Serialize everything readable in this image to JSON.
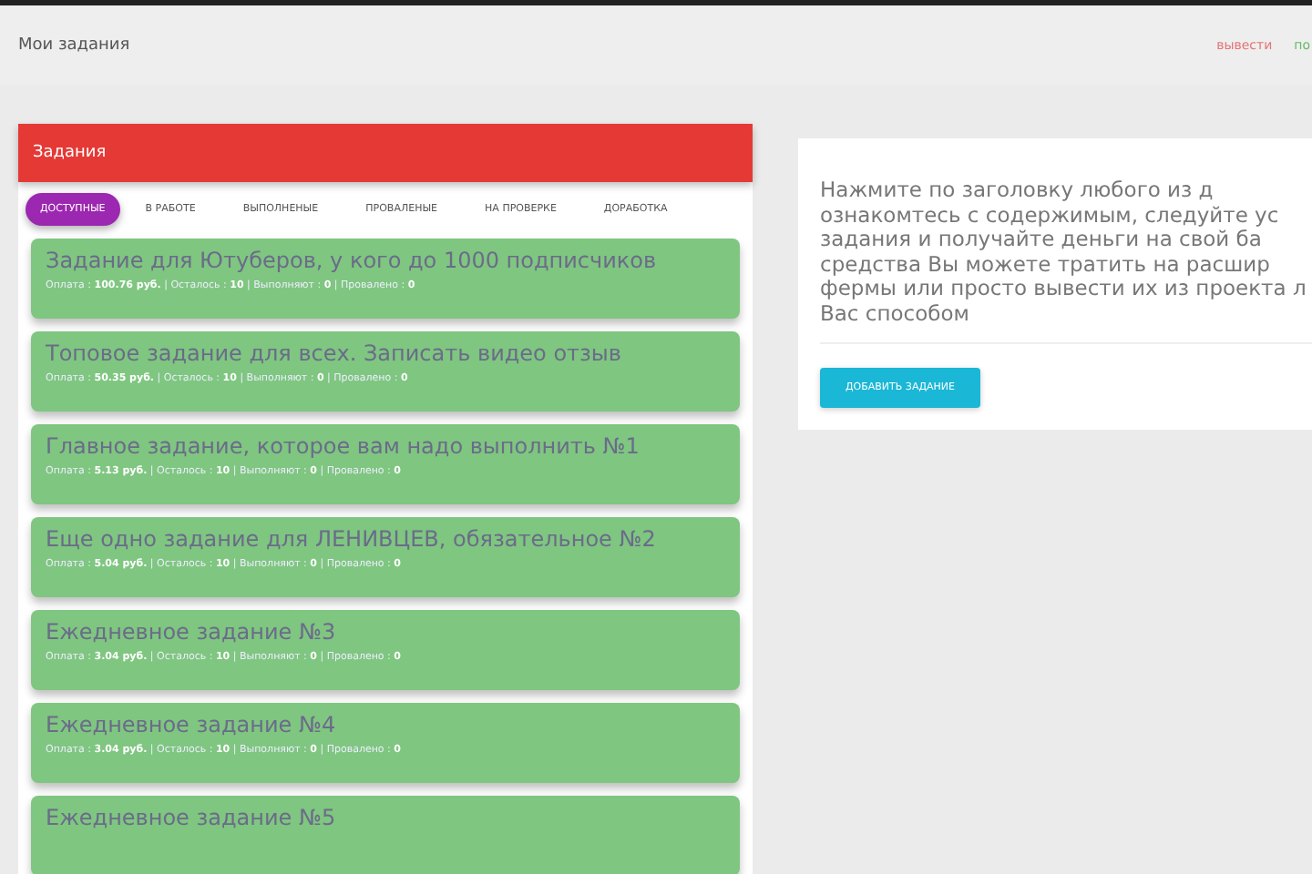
{
  "header": {
    "title": "Мои задания",
    "links": [
      {
        "label": "вывести",
        "color": "#e57373"
      },
      {
        "label": "по",
        "color": "#66bb6a"
      }
    ]
  },
  "tasks_panel": {
    "title": "Задания",
    "tabs": [
      {
        "label": "ДОСТУПНЫЕ",
        "selected": true
      },
      {
        "label": "В РАБОТЕ",
        "selected": false
      },
      {
        "label": "ВЫПОЛНЕНЫЕ",
        "selected": false
      },
      {
        "label": "ПРОВАЛЕНЫЕ",
        "selected": false
      },
      {
        "label": "НА ПРОВЕРКЕ",
        "selected": false
      },
      {
        "label": "ДОРАБОТКА",
        "selected": false
      }
    ],
    "tasks": [
      {
        "title": "Задание для Ютуберов, у кого до 1000 подписчиков",
        "meta": "Оплата : **100.76 руб.** | Осталось : **10** | Выполняют : **0** | Провалено : **0**"
      },
      {
        "title": "Топовое задание для всех. Записать видео отзыв",
        "meta": "Оплата : **50.35 руб.** | Осталось : **10** | Выполняют : **0** | Провалено : **0**"
      },
      {
        "title": "Главное задание, которое вам надо выполнить №1",
        "meta": "Оплата : **5.13 руб.** | Осталось : **10** | Выполняют : **0** | Провалено : **0**"
      },
      {
        "title": "Еще одно задание для ЛЕНИВЦЕВ, обязательное №2",
        "meta": "Оплата : **5.04 руб.** | Осталось : **10** | Выполняют : **0** | Провалено : **0**"
      },
      {
        "title": "Ежедневное задание №3",
        "meta": "Оплата : **3.04 руб.** | Осталось : **10** | Выполняют : **0** | Провалено : **0**"
      },
      {
        "title": "Ежедневное задание №4",
        "meta": "Оплата : **3.04 руб.** | Осталось : **10** | Выполняют : **0** | Провалено : **0**"
      },
      {
        "title": "Ежедневное задание №5"
      }
    ]
  },
  "info_panel": {
    "text_lines": [
      "Нажмите по заголовку любого из д",
      "ознакомтесь с содержимым, следуйте ус",
      "задания и получайте деньги на свой ба",
      "средства Вы можете тратить на расшир",
      "фермы или просто вывести их из проекта л",
      "Вас способом"
    ],
    "button": "ДОБАВИТЬ ЗАДАНИЕ"
  }
}
